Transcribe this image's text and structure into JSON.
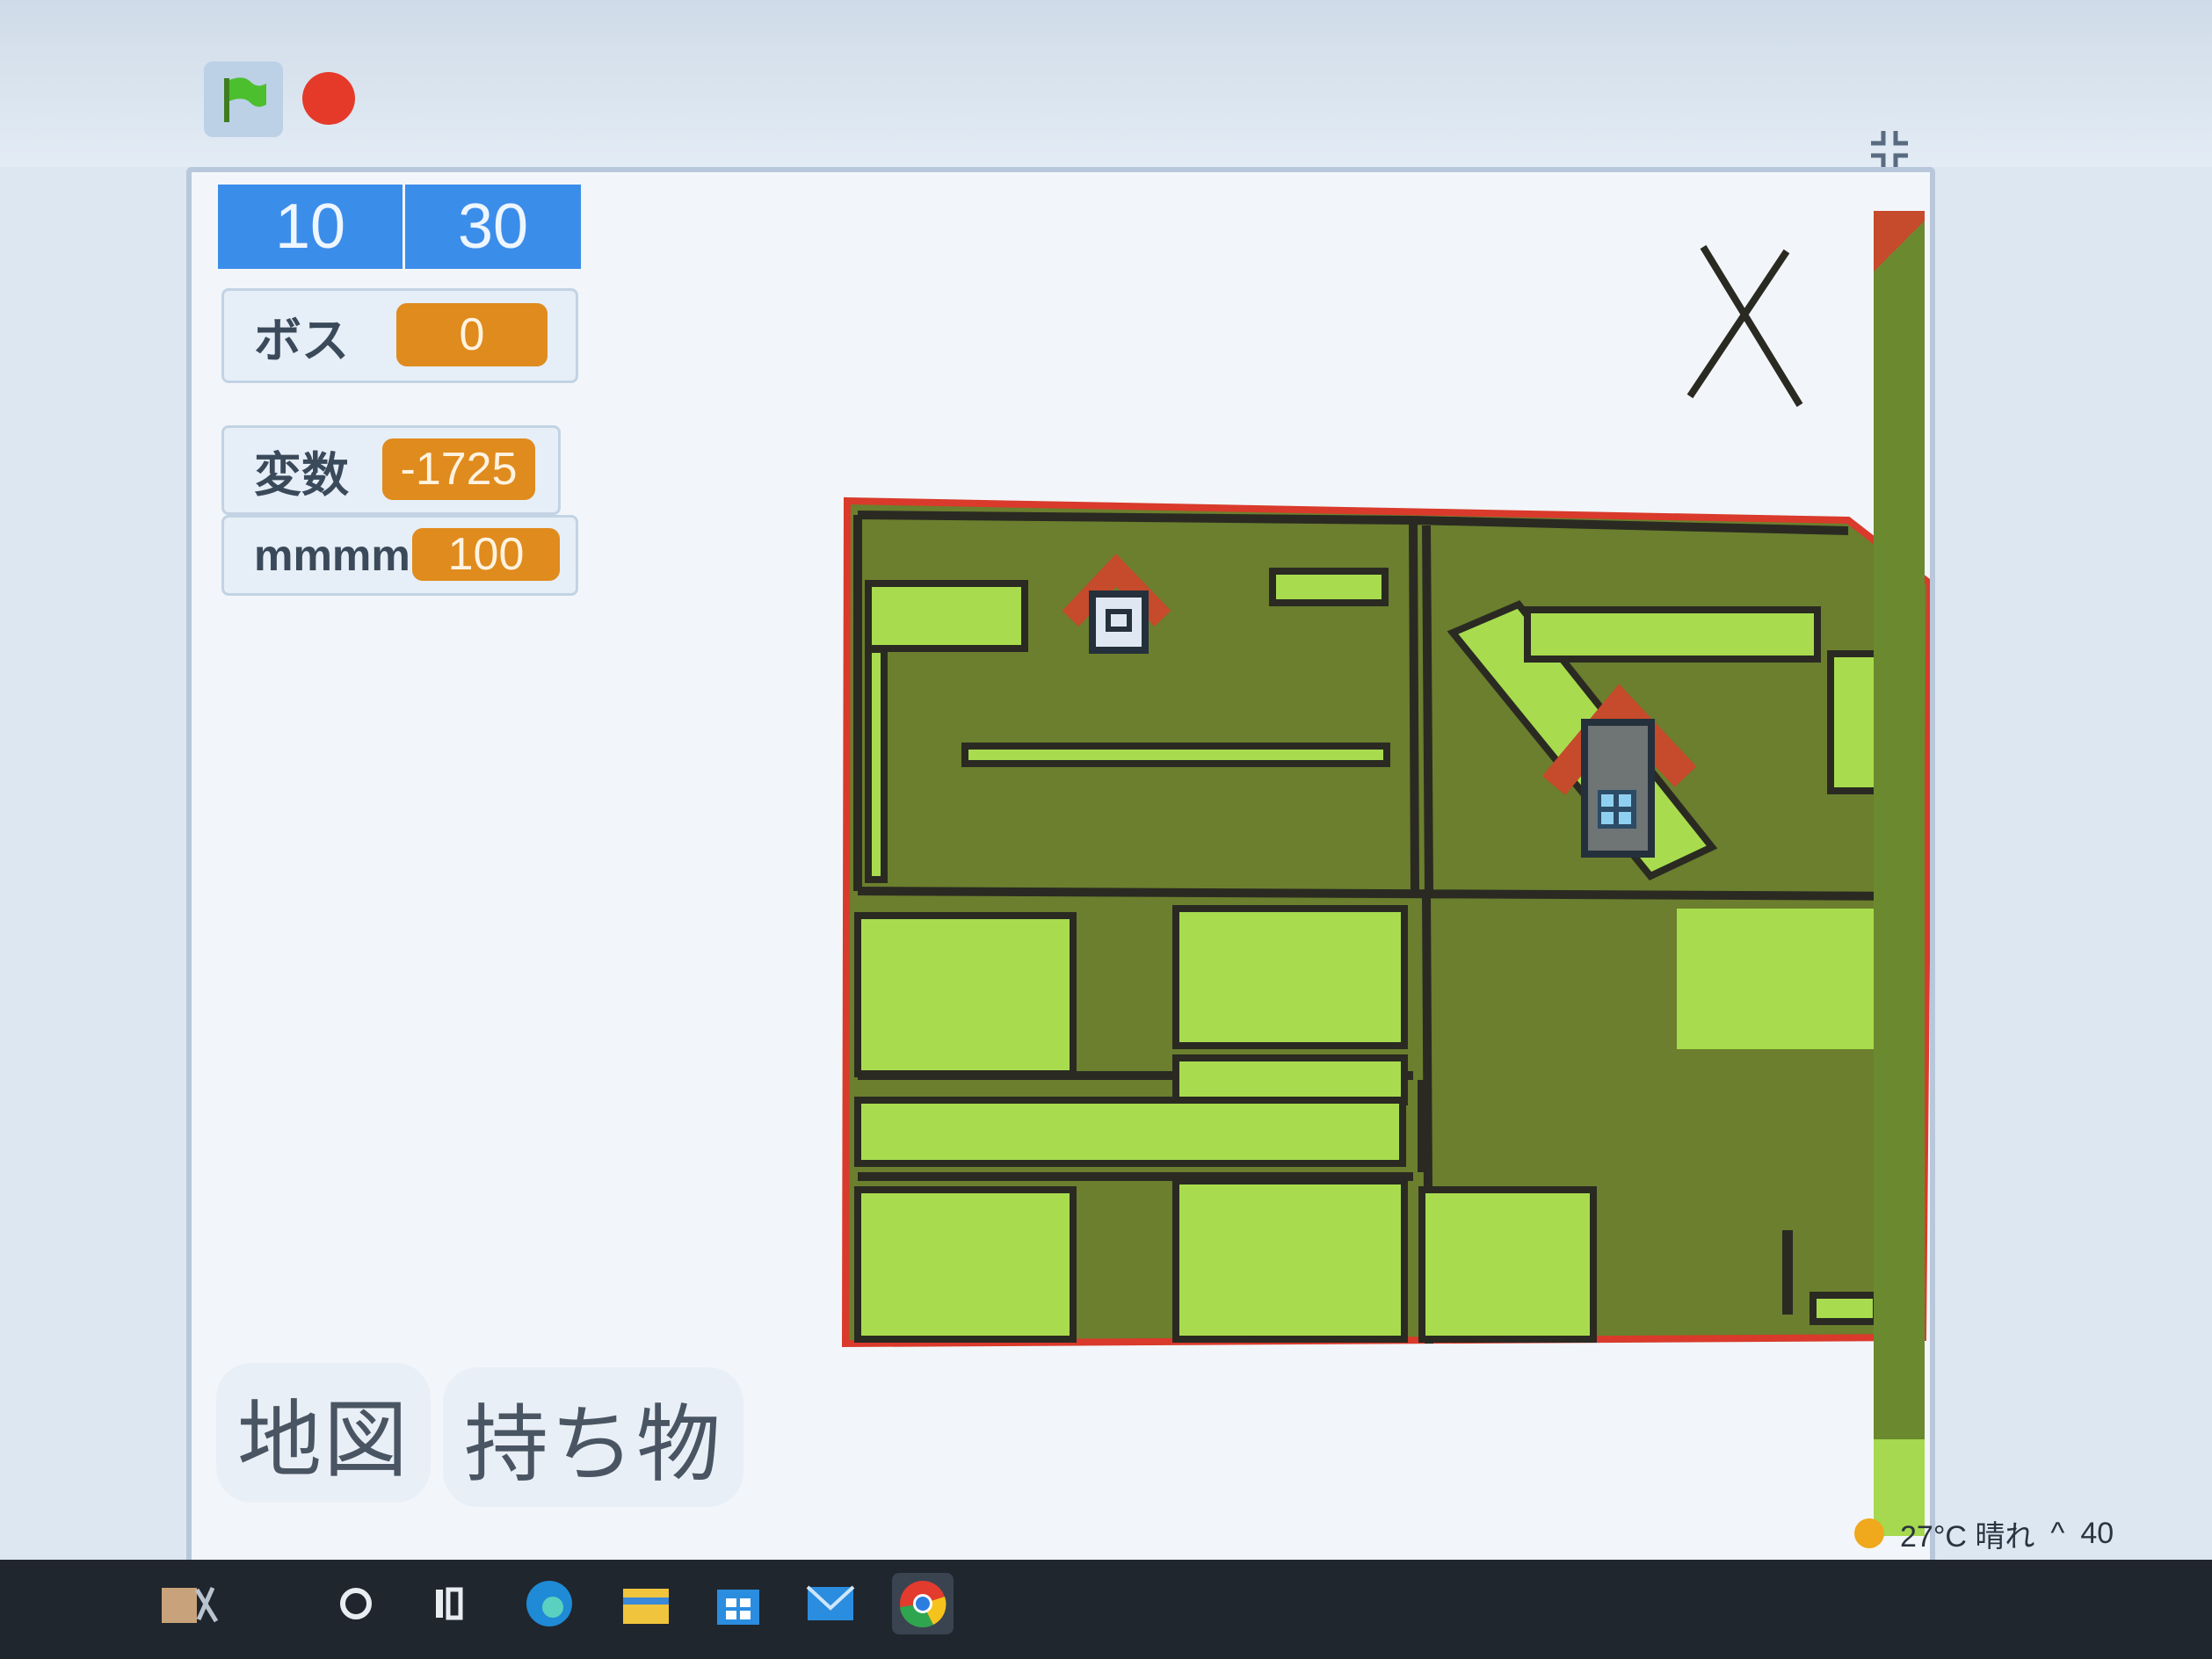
{
  "toolbar": {
    "green_flag_icon": "green-flag",
    "stop_icon": "stop-sign",
    "fullscreen_icon": "fullscreen-exit"
  },
  "monitors": {
    "top_left": "10",
    "top_right": "30",
    "boss": {
      "label": "ボス",
      "value": "0"
    },
    "hensu": {
      "label": "変数",
      "value": "-1725"
    },
    "mmmm": {
      "label": "mmmm",
      "value": "100"
    }
  },
  "tabs": {
    "map": "地図",
    "inventory": "持ち物"
  },
  "map": {
    "background": "#6b7f2e",
    "block_color": "#a8dc4e",
    "border_color": "#d93a2b",
    "close_icon": "close-x"
  },
  "tray": {
    "weather": "27°C 晴れ",
    "clock": "40"
  },
  "colors": {
    "stage_bg": "#f2f6fa",
    "monitor_blue": "#3b8dea",
    "monitor_orange": "#e08b1e",
    "taskbar": "#20262e"
  }
}
